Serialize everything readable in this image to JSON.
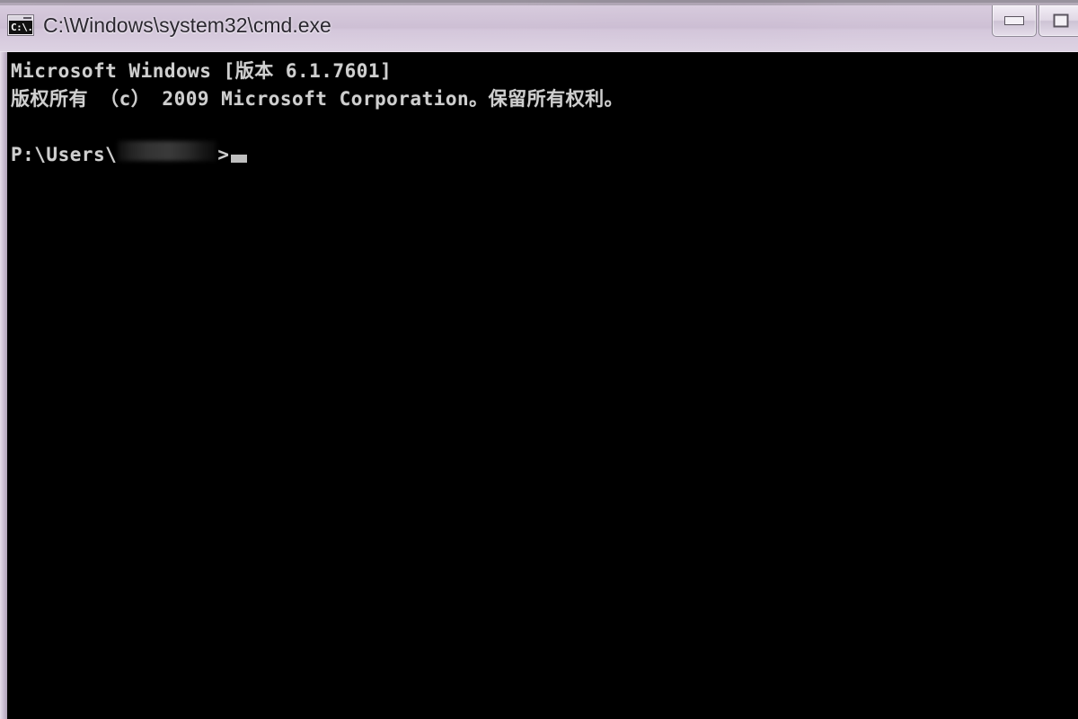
{
  "window": {
    "title": "C:\\Windows\\system32\\cmd.exe",
    "icon": "cmd-console-icon",
    "icon_text": "C:\\.",
    "controls": [
      {
        "name": "minimize",
        "glyph": "minimize-glyph"
      },
      {
        "name": "maximize",
        "glyph": "maximize-glyph"
      }
    ]
  },
  "console": {
    "background_color": "#000000",
    "text_color": "#cfcfcf",
    "lines": [
      "Microsoft Windows [版本 6.1.7601]",
      "版权所有 （c） 2009 Microsoft Corporation。保留所有权利。",
      "",
      ""
    ],
    "prompt": {
      "prefix": "P:\\Users\\",
      "username": "",
      "username_redacted": true,
      "suffix": ">",
      "cursor": "block"
    }
  },
  "desktop": {
    "aero_glass_color": "#cdbcd3",
    "titlebar_text_color": "#2b2730"
  }
}
